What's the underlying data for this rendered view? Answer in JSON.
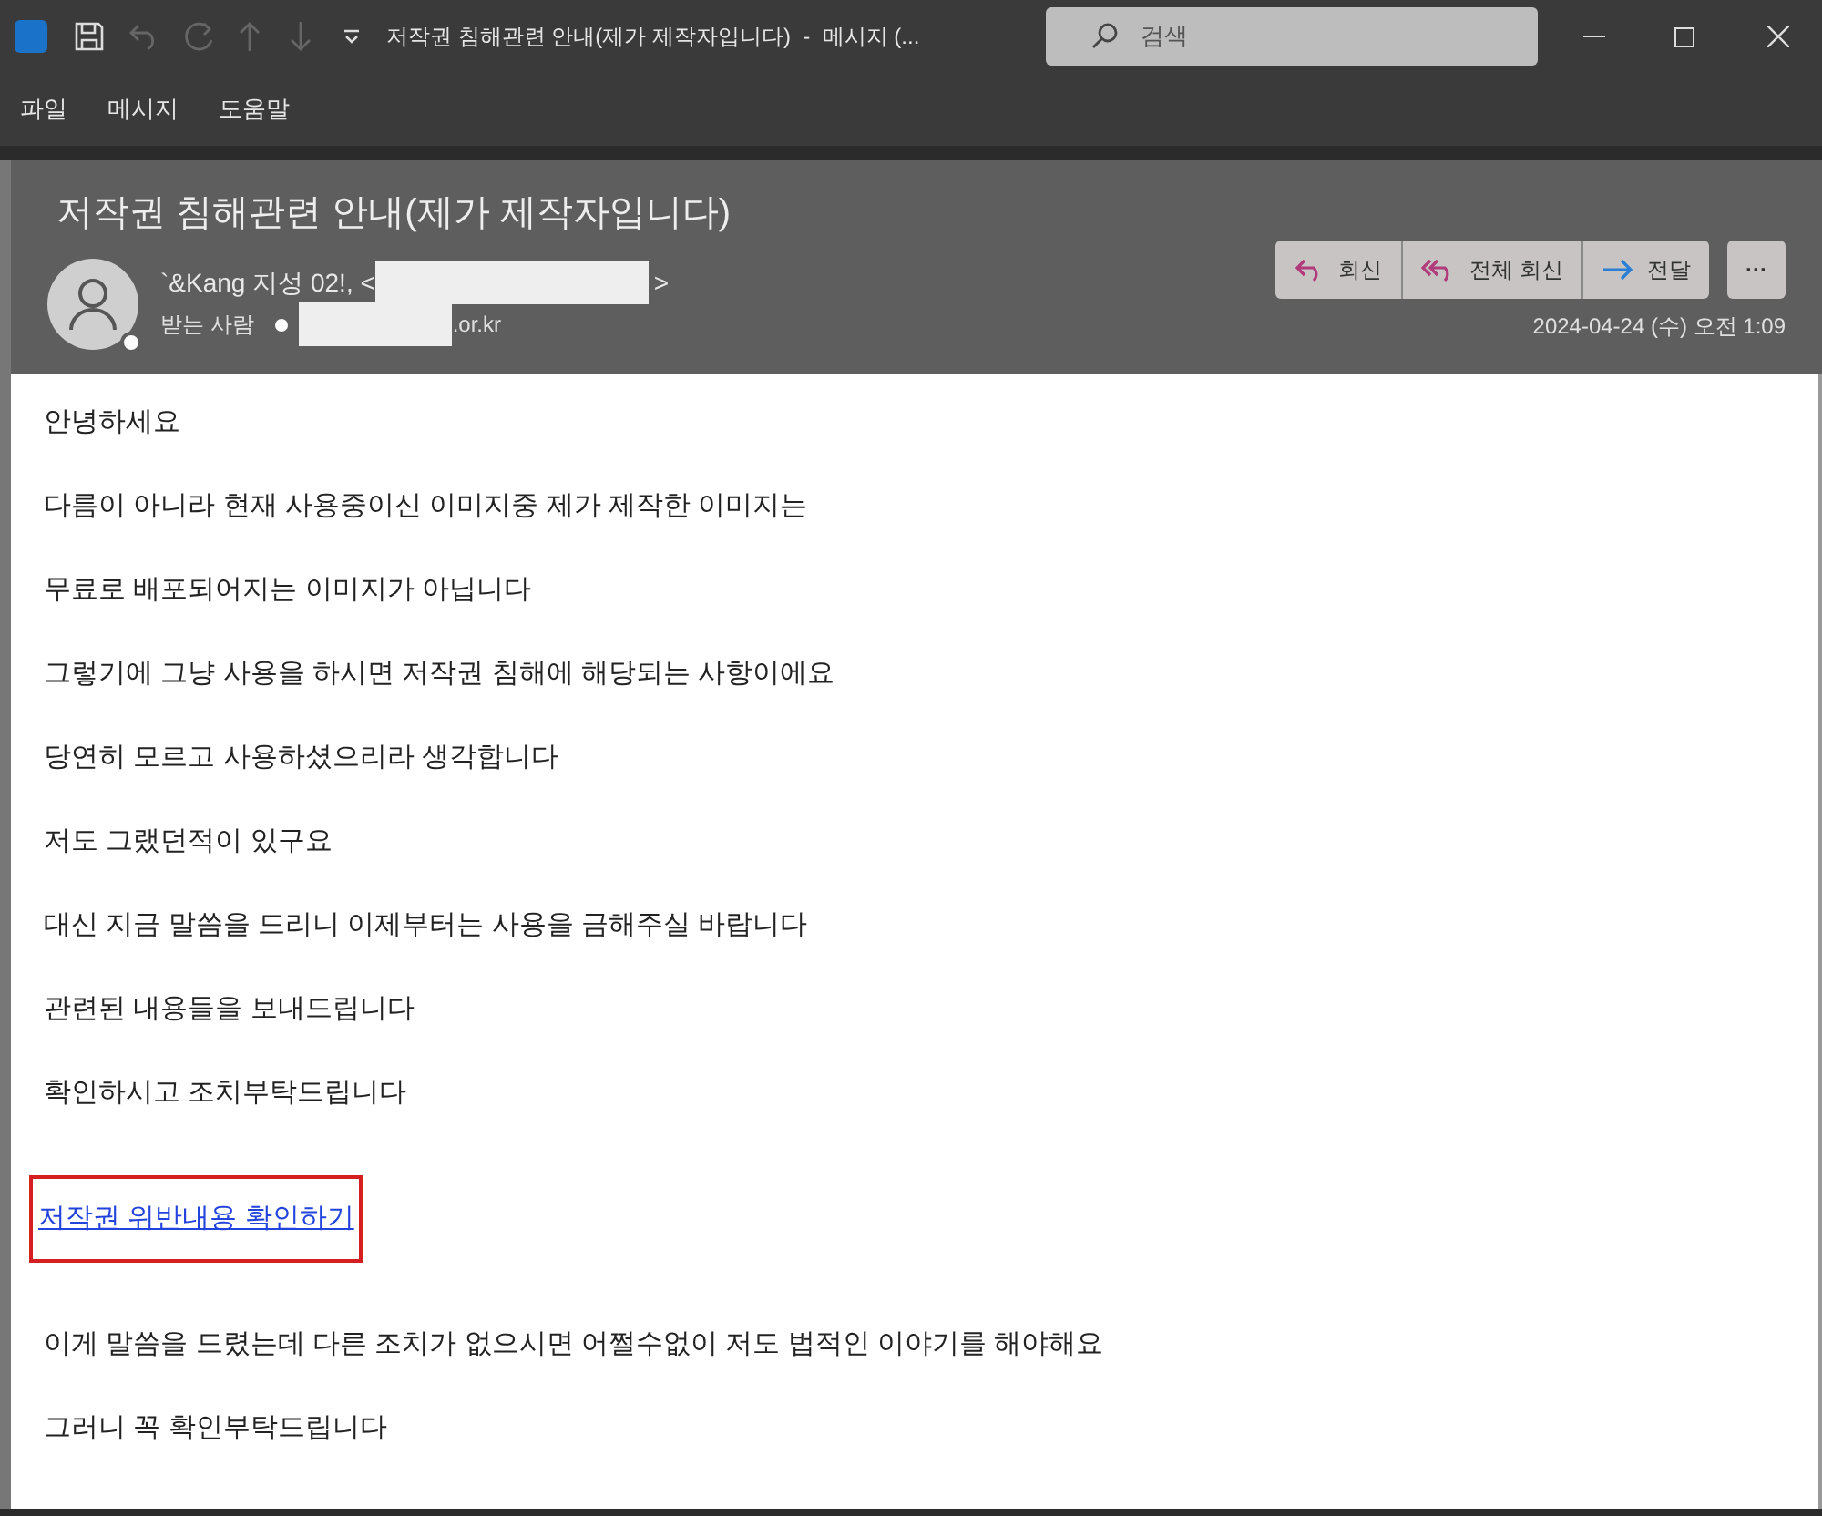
{
  "window": {
    "title": "저작권 침해관련 안내(제가 제작자입니다)  -  메시지 (..."
  },
  "search": {
    "placeholder": "검색"
  },
  "menu": [
    "파일",
    "메시지",
    "도움말"
  ],
  "message": {
    "subject": "저작권 침해관련 안내(제가 제작자입니다)",
    "sender": {
      "name": "`&Kang 지성 02!, <",
      "suffix": ">"
    },
    "recipient": {
      "label": "받는 사람",
      "suffix": ".or.kr"
    },
    "actions": [
      {
        "kind": "reply",
        "label": "회신"
      },
      {
        "kind": "reply-all",
        "label": "전체 회신"
      },
      {
        "kind": "forward",
        "label": "전달"
      }
    ],
    "more": "···",
    "date": "2024-04-24 (수) 오전 1:09"
  },
  "body": [
    {
      "kind": "text",
      "text": "안녕하세요"
    },
    {
      "kind": "text",
      "text": "다름이 아니라 현재 사용중이신 이미지중 제가 제작한 이미지는"
    },
    {
      "kind": "text",
      "text": "무료로 배포되어지는 이미지가 아닙니다"
    },
    {
      "kind": "text",
      "text": "그렇기에 그냥 사용을 하시면 저작권 침해에 해당되는 사항이에요"
    },
    {
      "kind": "text",
      "text": "당연히 모르고 사용하셨으리라 생각합니다"
    },
    {
      "kind": "text",
      "text": "저도 그랬던적이 있구요"
    },
    {
      "kind": "text",
      "text": "대신 지금 말씀을 드리니 이제부터는 사용을 금해주실 바랍니다"
    },
    {
      "kind": "text",
      "text": "관련된 내용들을 보내드립니다"
    },
    {
      "kind": "text",
      "text": "확인하시고 조치부탁드립니다"
    },
    {
      "kind": "link",
      "text": "저작권 위반내용 확인하기",
      "highlighted": true
    },
    {
      "kind": "text",
      "text": "이게 말씀을 드렸는데 다른 조치가 없으시면 어쩔수없이 저도 법적인 이야기를 해야해요"
    },
    {
      "kind": "text",
      "text": "그러니 꼭 확인부탁드립니다"
    }
  ]
}
